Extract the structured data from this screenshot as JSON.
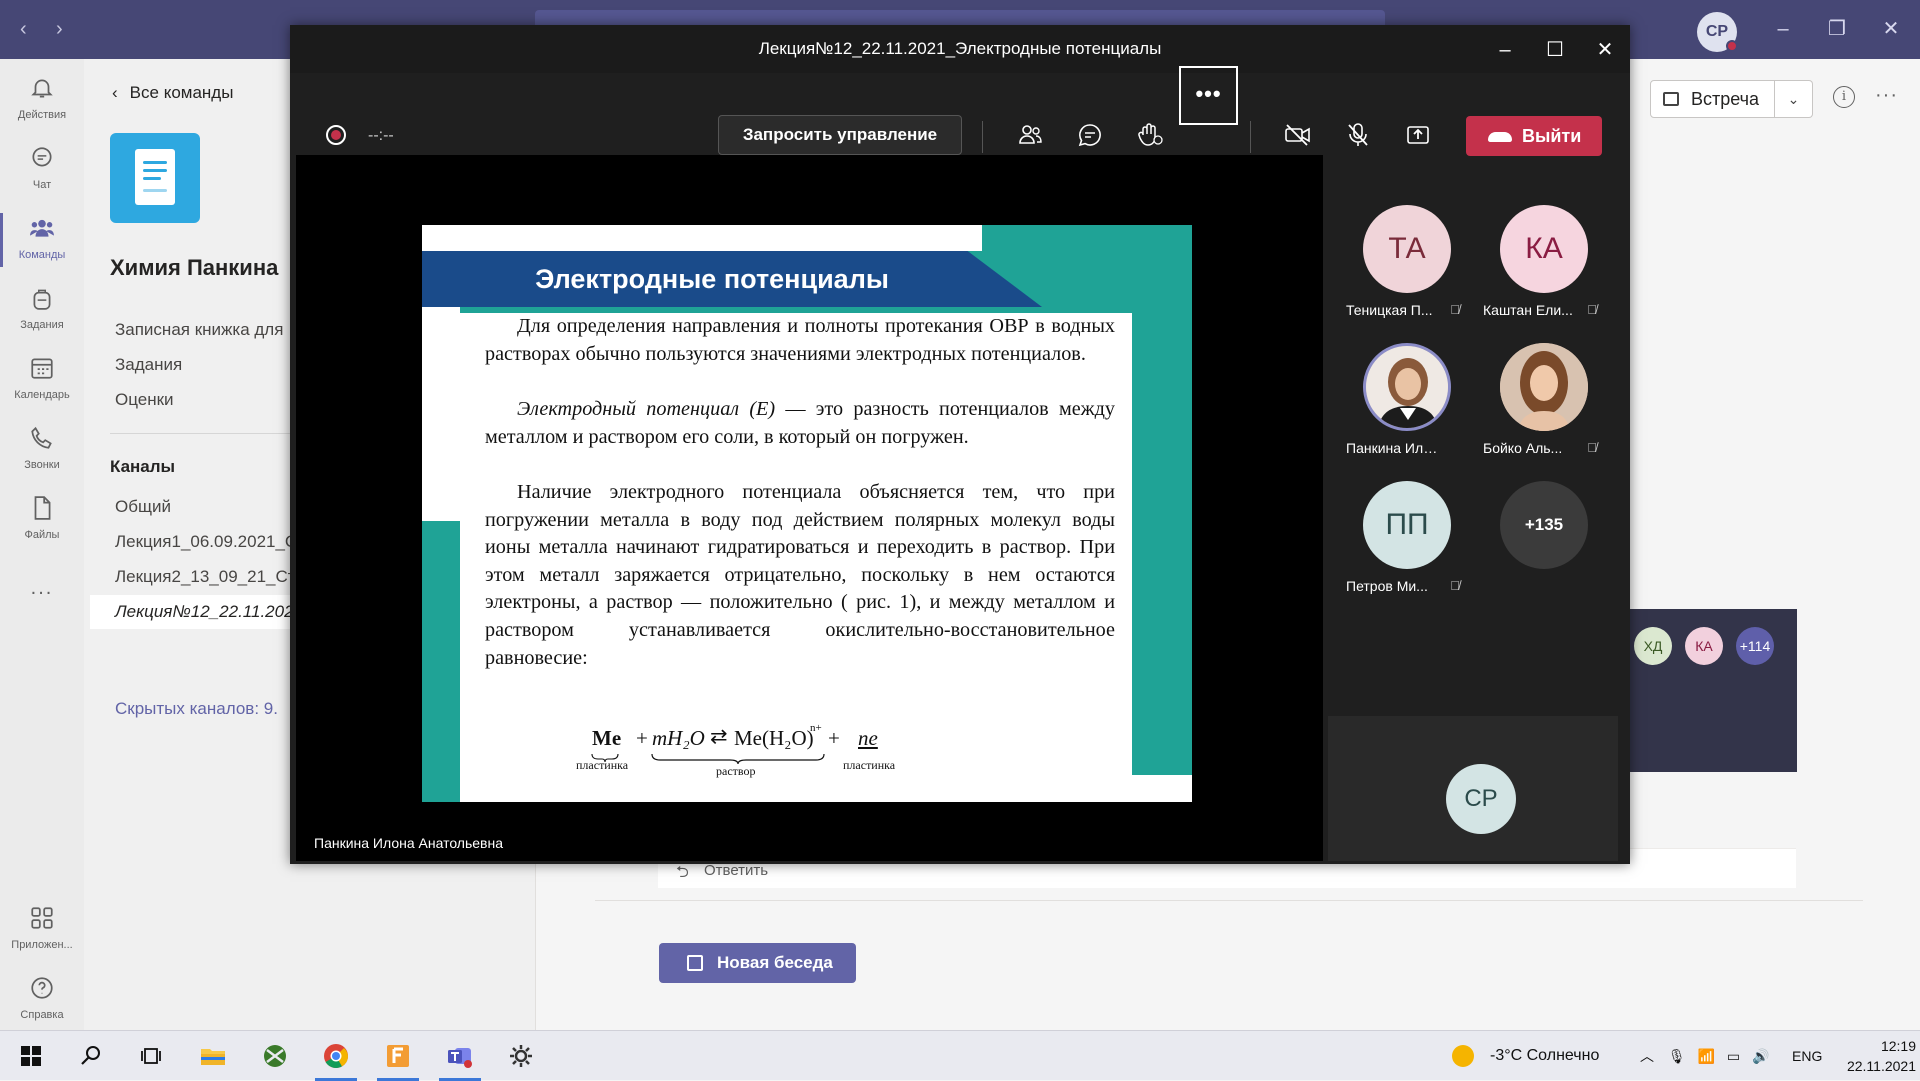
{
  "teams": {
    "user_initials": "СР",
    "rail": [
      {
        "label": "Действия"
      },
      {
        "label": "Чат"
      },
      {
        "label": "Команды"
      },
      {
        "label": "Задания"
      },
      {
        "label": "Календарь"
      },
      {
        "label": "Звонки"
      },
      {
        "label": "Файлы"
      },
      {
        "label": "..."
      },
      {
        "label": "Приложен..."
      },
      {
        "label": "Справка"
      }
    ],
    "back_link": "Все команды",
    "team_name": "Химия Панкина",
    "team_links": [
      "Записная книжка для",
      "Задания",
      "Оценки"
    ],
    "channels_heading": "Каналы",
    "channels": [
      "Общий",
      "Лекция1_06.09.2021_С",
      "Лекция2_13_09_21_Ст",
      "Лекция№12_22.11.202"
    ],
    "hidden_channels": "Скрытых каналов: 9.",
    "meet_button": "Встреча",
    "reply": "Ответить",
    "new_conversation": "Новая беседа",
    "card_avatars": [
      {
        "initials": "ХД",
        "bg": "#dbe8d0",
        "fg": "#3b5a25"
      },
      {
        "initials": "КА",
        "bg": "#f2d0dd",
        "fg": "#8a1c42"
      },
      {
        "initials": "+114",
        "bg": "#5f5faa",
        "fg": "#ffffff"
      }
    ]
  },
  "meeting": {
    "title": "Лекция№12_22.11.2021_Электродные потенциалы",
    "timer": "--:--",
    "request_control": "Запросить управление",
    "more": "•••",
    "leave": "Выйти",
    "presenter": "Панкина Илона Анатольевна",
    "participants": [
      {
        "initials": "ТА",
        "name": "Теницкая П...",
        "muted": true,
        "bg": "#f0d4d9",
        "fg": "#7a2b3a"
      },
      {
        "initials": "КА",
        "name": "Каштан Ели...",
        "muted": true,
        "bg": "#f6d5df",
        "fg": "#8a1c42"
      },
      {
        "initials": "",
        "name": "Панкина Илон...",
        "muted": false,
        "photo": true
      },
      {
        "initials": "",
        "name": "Бойко Аль...",
        "muted": true,
        "photo": true
      },
      {
        "initials": "ПП",
        "name": "Петров Ми...",
        "muted": true,
        "bg": "#d3e4e4",
        "fg": "#2b4b4b"
      },
      {
        "initials": "+135",
        "name": "",
        "muted": false,
        "bg": "#3b3b3b",
        "fg": "#ffffff"
      }
    ],
    "self_initials": "СР"
  },
  "slide": {
    "title": "Электродные потенциалы",
    "paragraphs": [
      "Для определения направления и полноты протекания ОВР в водных растворах обычно пользуются значениями электродных потенциалов.",
      "Электродный потенциал (E) — это разность потенциалов между металлом и раствором его соли, в который он погружен.",
      "Наличие электродного потенциала объясняется тем, что при погружении металла в воду под действием полярных молекул воды ионы металла начинают гидратироваться и переходить в раствор. При этом металл заряжается отрицательно, поскольку в нем остаются электроны, а раствор — положительно ( рис. 1), и между металлом и раствором устанавливается окислительно-восстановительное равновесие:"
    ],
    "para2_lead": "Электродный потенциал (E)",
    "para2_rest": " — это разность потенциалов между металлом и раствором его соли, в который он погружен.",
    "formula": {
      "me": "Me",
      "plus1": "+",
      "water": "mH₂O",
      "arrow": "⇄",
      "complex": "Me(H₂O)",
      "charge": "n+",
      "plus2": "+",
      "electrons": "ne",
      "sub_left": "пластинка",
      "sub_mid": "раствор",
      "sub_right": "пластинка"
    }
  },
  "taskbar": {
    "weather": "-3°C  Солнечно",
    "lang": "ENG",
    "time": "12:19",
    "date": "22.11.2021"
  }
}
